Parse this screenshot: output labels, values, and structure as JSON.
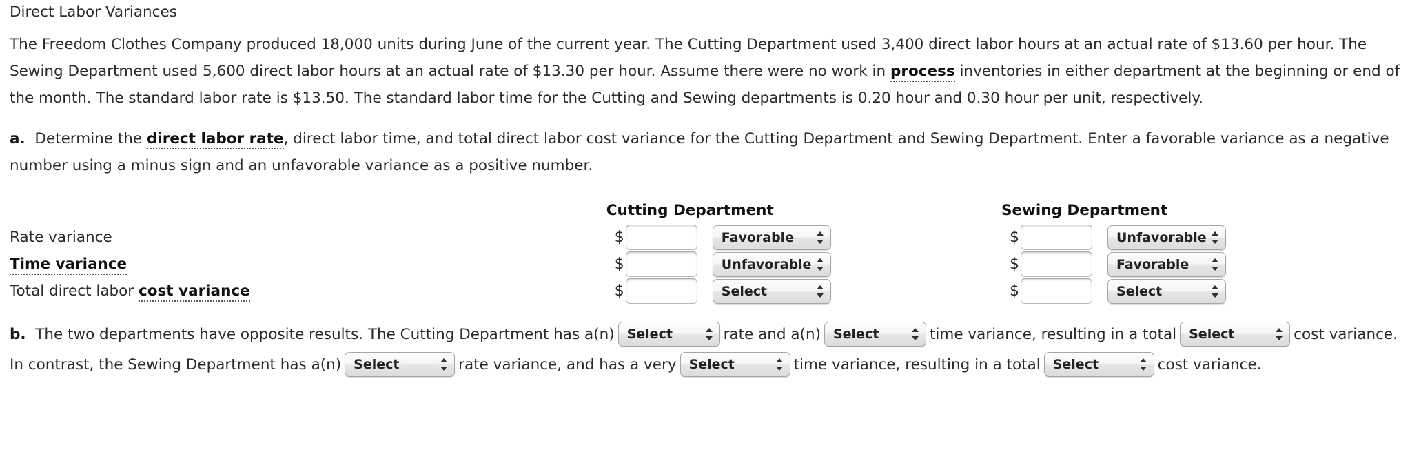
{
  "title": "Direct Labor Variances",
  "problem": {
    "segments": [
      {
        "text": "The Freedom Clothes Company produced 18,000 units during June of the current year. The Cutting Department used 3,400 direct labor hours at an actual rate of $13.60 per hour. The Sewing Department used 5,600 direct labor hours at an actual rate of $13.30 per hour. Assume there were no work in "
      },
      {
        "text": "process",
        "style": "term"
      },
      {
        "text": " inventories in either department at the beginning or end of the month. The standard labor rate is $13.50. The standard labor time for the Cutting and Sewing departments is 0.20 hour and 0.30 hour per unit, respectively."
      }
    ]
  },
  "part_a": {
    "marker": "a.",
    "text_1": "Determine the ",
    "term": "direct labor rate",
    "text_2": ", direct labor time, and total direct labor cost variance for the Cutting Department and Sewing Department. Enter a favorable variance as a negative number using a minus sign and an unfavorable variance as a positive number."
  },
  "table": {
    "columns": [
      "Cutting Department",
      "Sewing Department"
    ],
    "currency_symbol": "$",
    "rows": [
      {
        "label_plain": "Rate variance",
        "label_pre": "Rate variance",
        "label_term": "",
        "cutting": {
          "amount": "",
          "placeholder": "",
          "select": "Favorable"
        },
        "sewing": {
          "amount": "",
          "placeholder": "",
          "select": "Unfavorable"
        }
      },
      {
        "label_plain": "Time variance",
        "label_pre": "",
        "label_term": "Time variance",
        "cutting": {
          "amount": "",
          "placeholder": "",
          "select": "Unfavorable"
        },
        "sewing": {
          "amount": "",
          "placeholder": "",
          "select": "Favorable"
        }
      },
      {
        "label_plain": "Total direct labor cost variance",
        "label_pre": "Total direct labor ",
        "label_term": "cost variance",
        "cutting": {
          "amount": "",
          "placeholder": "",
          "select": "Select"
        },
        "sewing": {
          "amount": "",
          "placeholder": "",
          "select": "Select"
        }
      }
    ]
  },
  "part_b": {
    "marker": "b.",
    "t1": "The two departments have opposite results. The Cutting Department has a(n)",
    "sel1": "Select",
    "t2": "rate and a(n)",
    "sel2": "Select",
    "t3": "time variance, resulting in a total",
    "sel3": "Select",
    "t4": "cost variance. In contrast, the Sewing Department has a(n)",
    "sel4": "Select",
    "t5": "rate variance, and has a very",
    "sel5": "Select",
    "t6": "time variance, resulting in a total",
    "sel6": "Select",
    "t7": "cost variance."
  }
}
